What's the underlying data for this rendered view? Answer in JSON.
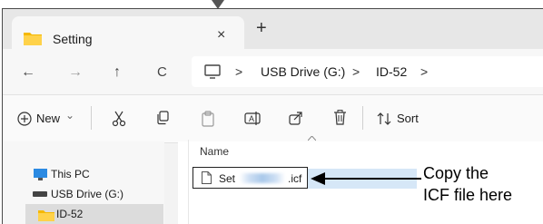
{
  "window": {
    "tab_title": "Setting",
    "tab_close_glyph": "×",
    "new_tab_glyph": "+"
  },
  "nav": {
    "back_glyph": "←",
    "forward_glyph": "→",
    "up_glyph": "↑",
    "refresh_glyph": "C",
    "breadcrumbs": [
      "USB Drive (G:)",
      "ID-52"
    ],
    "separator_glyph": ">"
  },
  "toolbar": {
    "new_label": "New",
    "new_chevron": "⌄",
    "sort_label": "Sort"
  },
  "sidebar": {
    "items": [
      {
        "label": "This PC",
        "icon": "monitor-icon"
      },
      {
        "label": "USB Drive (G:)",
        "icon": "drive-icon"
      },
      {
        "label": "ID-52",
        "icon": "folder-icon"
      }
    ]
  },
  "file_list": {
    "column_name": "Name",
    "file_name_prefix": "Set",
    "file_name_suffix": ".icf"
  },
  "annotation": {
    "line1": "Copy the",
    "line2": "ICF file here"
  }
}
